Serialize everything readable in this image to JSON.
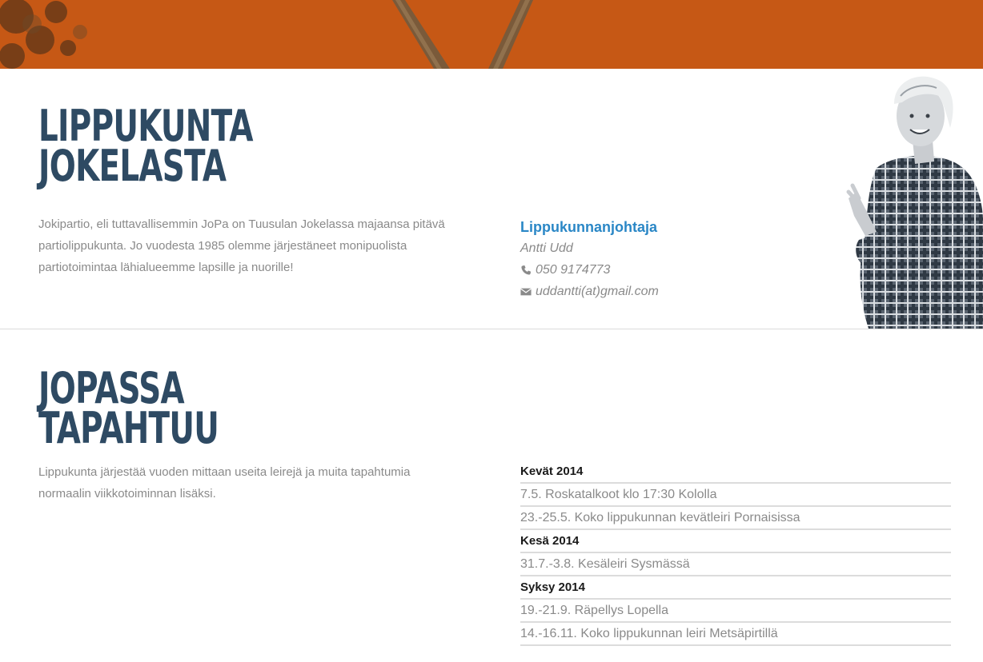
{
  "header": {
    "brand_color": "#c65815"
  },
  "section1": {
    "heading_lines": [
      "LIPPUKUNTA",
      "JOKELASTA"
    ],
    "intro": "Jokipartio, eli tuttavallisemmin JoPa on Tuusulan Jokelassa majaansa pitävä partiolippukunta. Jo vuodesta 1985 olemme järjestäneet monipuolista partiotoimintaa lähialueemme lapsille ja nuorille!",
    "contact": {
      "role": "Lippukunnanjohtaja",
      "name": "Antti Udd",
      "phone": "050 9174773",
      "phone_icon": "phone-icon",
      "email": "uddantti(at)gmail.com",
      "email_icon": "envelope-icon"
    }
  },
  "section2": {
    "heading_lines": [
      "JOPASSA",
      "TAPAHTUU"
    ],
    "intro": "Lippukunta järjestää vuoden mittaan useita leirejä ja muita tapahtumia normaalin viikkotoiminnan lisäksi.",
    "events": [
      {
        "type": "season",
        "text": "Kevät 2014"
      },
      {
        "type": "event",
        "text": "7.5. Roskatalkoot klo 17:30 Kololla"
      },
      {
        "type": "event",
        "text": "23.-25.5. Koko lippukunnan kevätleiri Pornaisissa"
      },
      {
        "type": "season",
        "text": "Kesä 2014"
      },
      {
        "type": "event",
        "text": "31.7.-3.8. Kesäleiri Sysmässä"
      },
      {
        "type": "season",
        "text": "Syksy 2014"
      },
      {
        "type": "event",
        "text": "19.-21.9. Räpellys Lopella"
      },
      {
        "type": "event",
        "text": "14.-16.11. Koko lippukunnan leiri Metsäpirtillä"
      }
    ]
  }
}
